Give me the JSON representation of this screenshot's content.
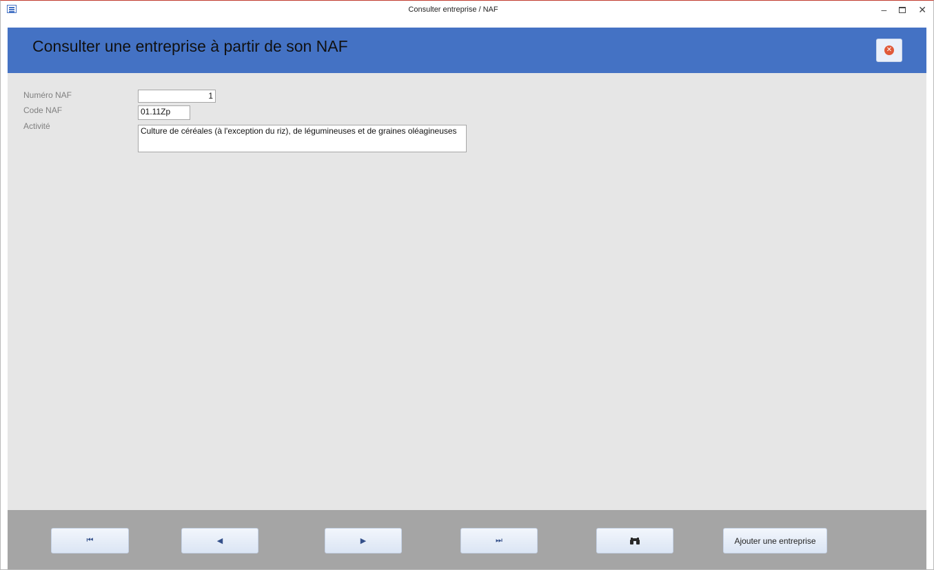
{
  "window": {
    "title": "Consulter entreprise / NAF",
    "controls": {
      "minimize": "–",
      "close": "✕"
    }
  },
  "header": {
    "title": "Consulter une entreprise à partir de son NAF",
    "close_icon": "close-circle-icon"
  },
  "form": {
    "numero_label": "Numéro NAF",
    "numero_value": "1",
    "code_label": "Code NAF",
    "code_value": "01.11Zp",
    "activite_label": "Activité",
    "activite_value": "Culture de céréales (à l'exception du riz), de légumineuses et de graines oléagineuses"
  },
  "footer": {
    "first_glyph": "⏮",
    "prev_glyph": "◀",
    "next_glyph": "▶",
    "last_glyph": "⏭",
    "search_icon": "binoculars-icon",
    "add_label": "Ajouter une entreprise"
  },
  "colors": {
    "header": "#4472c4",
    "content": "#e6e6e6",
    "footer": "#a5a5a5"
  }
}
